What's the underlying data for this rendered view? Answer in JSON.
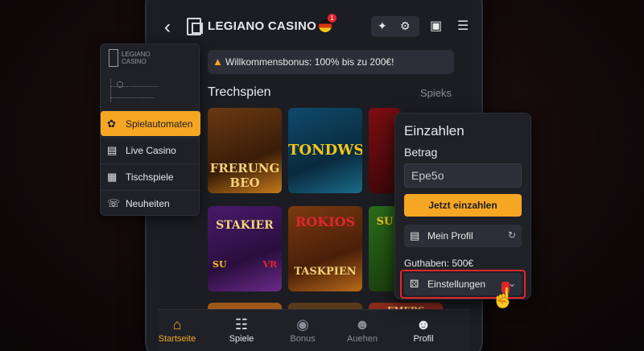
{
  "header": {
    "brand": "LEGIANO CASINO",
    "flag_badge": "1"
  },
  "banner": {
    "text": "Willkommensbonus: 100% bis zu 200€!"
  },
  "section": {
    "title": "Trechspien",
    "more": "Spieks"
  },
  "tiles": {
    "t1": [
      "FRERUNG",
      "BEO"
    ],
    "t2": "TONDWS",
    "t4": [
      "STAKIER",
      "SU",
      "VR"
    ],
    "t5": [
      "ROKIOS",
      "TASKPIEN"
    ],
    "t6": "SU",
    "t9": "EMERS"
  },
  "sidebar": {
    "logo": [
      "LEGIANO",
      "CASINO"
    ],
    "items": [
      {
        "label": "Spielautomaten",
        "icon": "slot-icon"
      },
      {
        "label": "Live Casino",
        "icon": "calendar-icon"
      },
      {
        "label": "Tischspiele",
        "icon": "grid-icon"
      },
      {
        "label": "Neuheiten",
        "icon": "phone-icon"
      }
    ]
  },
  "deposit": {
    "title": "Einzahlen",
    "amount_label": "Betrag",
    "amount_value": "Epe5o",
    "submit_label": "Jetzt einzahlen",
    "profile_label": "Mein Profil",
    "balance": "Guthaben: 500€",
    "settings_label": "Einstellungen"
  },
  "nav": [
    {
      "label": "Startseite",
      "icon": "home-icon"
    },
    {
      "label": "Spiele",
      "icon": "gamepad-icon"
    },
    {
      "label": "Bonus",
      "icon": "bonus-icon"
    },
    {
      "label": "Auehen",
      "icon": "user-icon"
    },
    {
      "label": "Profil",
      "icon": "profile-icon"
    }
  ],
  "colors": {
    "accent": "#f5a623",
    "highlight": "#e0262c",
    "background": "#1b1d22"
  }
}
